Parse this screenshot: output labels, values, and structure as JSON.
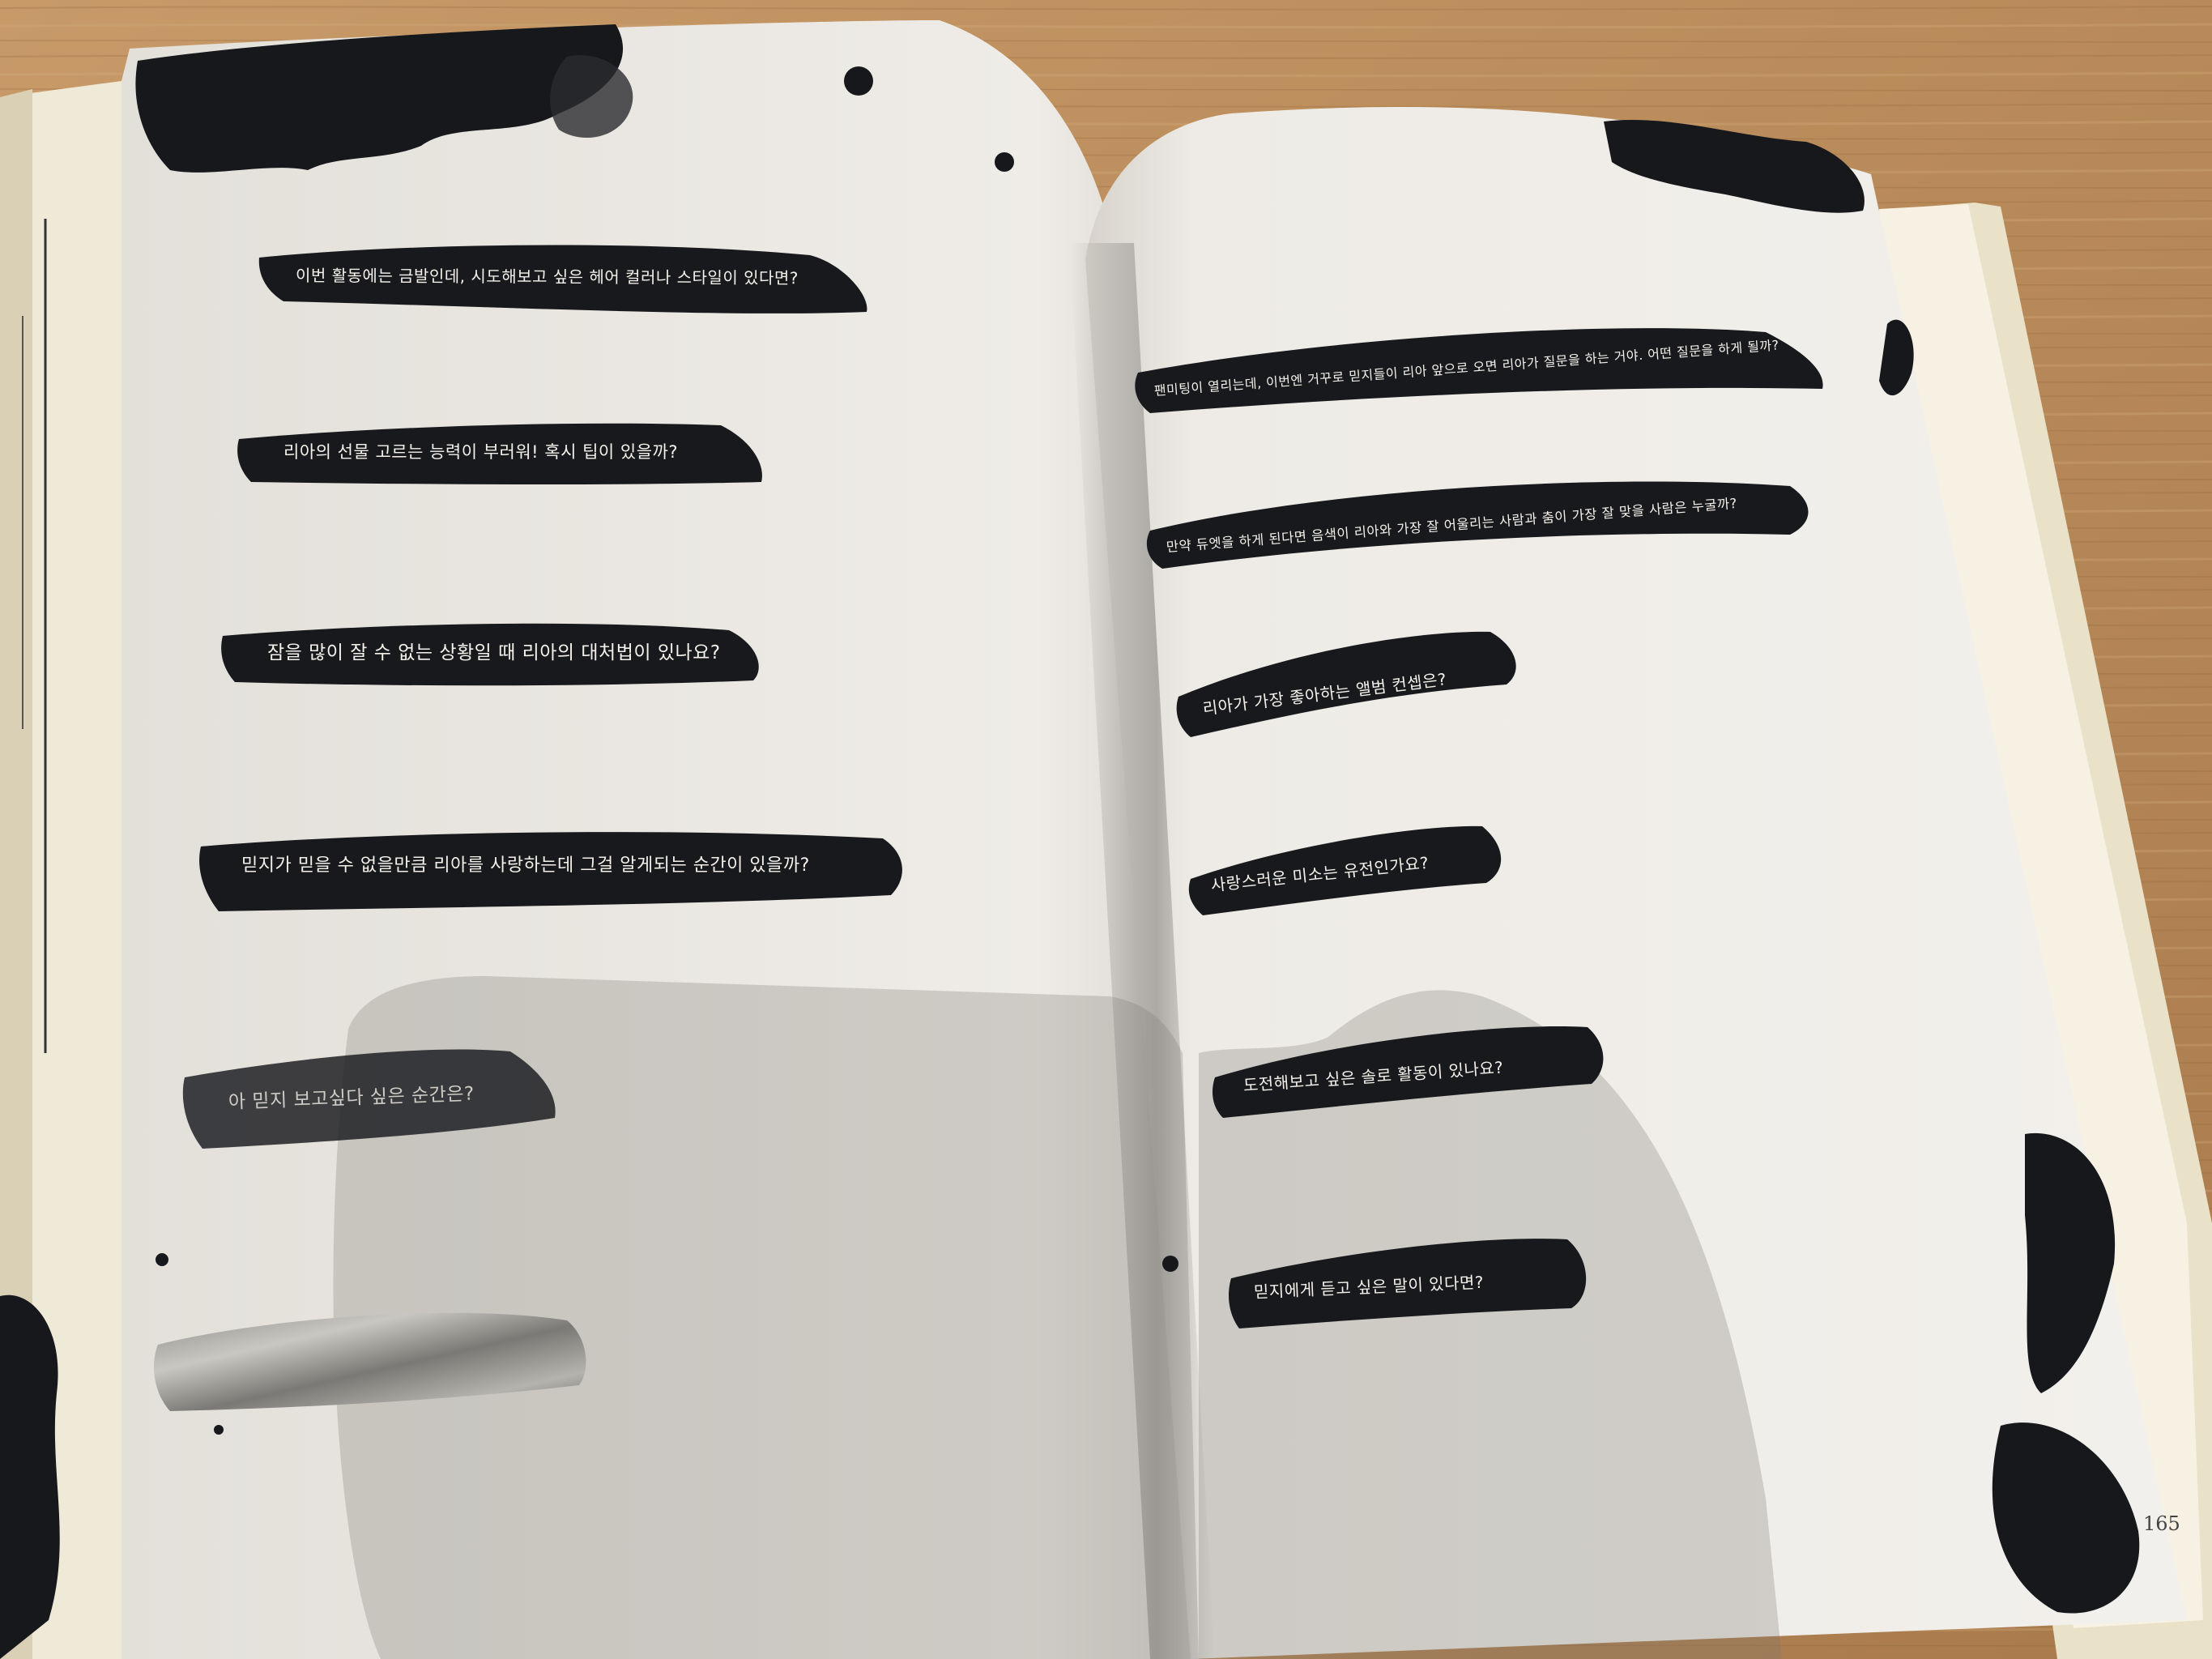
{
  "left_page": {
    "prompts": [
      "이번 활동에는 금발인데, 시도해보고 싶은 헤어 컬러나 스타일이 있다면?",
      "리아의 선물 고르는 능력이 부러워! 혹시 팁이 있을까?",
      "잠을 많이 잘 수 없는 상황일 때 리아의 대처법이 있나요?",
      "믿지가 믿을 수 없을만큼 리아를 사랑하는데 그걸 알게되는 순간이 있을까?",
      "아 믿지 보고싶다 싶은 순간은?"
    ]
  },
  "right_page": {
    "prompts": [
      "팬미팅이 열리는데, 이번엔 거꾸로 믿지들이 리아 앞으로 오면 리아가 질문을 하는 거야. 어떤 질문을 하게 될까?",
      "만약 듀엣을 하게 된다면 음색이 리아와 가장 잘 어울리는 사람과 춤이 가장 잘 맞을 사람은 누굴까?",
      "리아가 가장 좋아하는 앨범 컨셉은?",
      "사랑스러운 미소는 유전인가요?",
      "도전해보고 싶은 솔로 활동이 있나요?",
      "믿지에게 듣고 싶은 말이 있다면?"
    ],
    "page_number": "165"
  },
  "colors": {
    "table": "#b98c5c",
    "paper": "#efece7",
    "ink": "#17191d",
    "brush_text": "#f4f1ea"
  }
}
